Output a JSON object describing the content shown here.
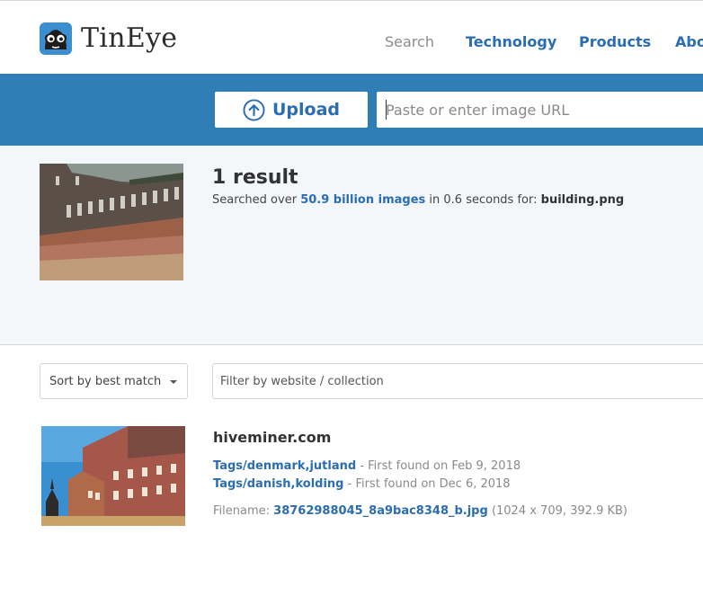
{
  "app": {
    "name": "TinEye"
  },
  "nav": {
    "items": [
      {
        "label": "Search"
      },
      {
        "label": "Technology"
      },
      {
        "label": "Products"
      },
      {
        "label": "About"
      }
    ]
  },
  "upload": {
    "label": "Upload",
    "url_placeholder": "Paste or enter image URL"
  },
  "summary": {
    "result_count": "1 result",
    "prefix": "Searched over",
    "images_link": "50.9 billion images",
    "middle": "in 0.6 seconds for:",
    "filename": "building.png"
  },
  "filters": {
    "sort_label": "Sort by best match",
    "filter_placeholder": "Filter by website / collection"
  },
  "match": {
    "domain": "hiveminer.com",
    "entries": [
      {
        "link": "Tags/denmark,jutland",
        "found": "- First found on Feb 9, 2018"
      },
      {
        "link": "Tags/danish,kolding",
        "found": "- First found on Dec 6, 2018"
      }
    ],
    "filename_label": "Filename:",
    "filename": "38762988045_8a9bac8348_b.jpg",
    "dims": "(1024 x 709, 392.9 KB)"
  },
  "colors": {
    "accent": "#2a6db2",
    "bar": "#2f7fb6",
    "summary_bg": "#f3f7fa"
  },
  "icons": {
    "logo": "tineye-robot-icon",
    "upload": "upload-arrow-icon",
    "sort": "caret-down-icon"
  }
}
